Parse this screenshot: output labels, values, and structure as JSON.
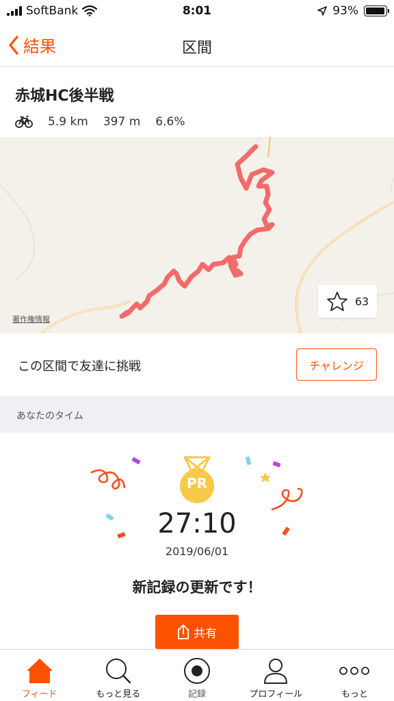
{
  "status_bar": {
    "carrier": "SoftBank",
    "time": "8:01",
    "battery": "93%"
  },
  "nav": {
    "back_label": "結果",
    "title": "区間"
  },
  "segment": {
    "name": "赤城HC後半戦",
    "distance": "5.9 km",
    "elevation": "397 m",
    "grade": "6.6%"
  },
  "map": {
    "credit": "著作権情報",
    "star_count": "63"
  },
  "challenge": {
    "text": "この区間で友達に挑戦",
    "button_label": "チャレンジ"
  },
  "your_time": {
    "section_title": "あなたのタイム",
    "medal_label": "PR",
    "time": "27:10",
    "date": "2019/06/01",
    "message": "新記録の更新です！",
    "share_label": "共有"
  },
  "tabs": [
    {
      "label": "フィード",
      "icon": "home-icon"
    },
    {
      "label": "もっと見る",
      "icon": "search-icon"
    },
    {
      "label": "記録",
      "icon": "record-icon"
    },
    {
      "label": "プロフィール",
      "icon": "profile-icon"
    },
    {
      "label": "もっと",
      "icon": "more-icon"
    }
  ],
  "colors": {
    "accent": "#fc5200",
    "route": "#f26b6b",
    "medal": "#f7c948"
  }
}
